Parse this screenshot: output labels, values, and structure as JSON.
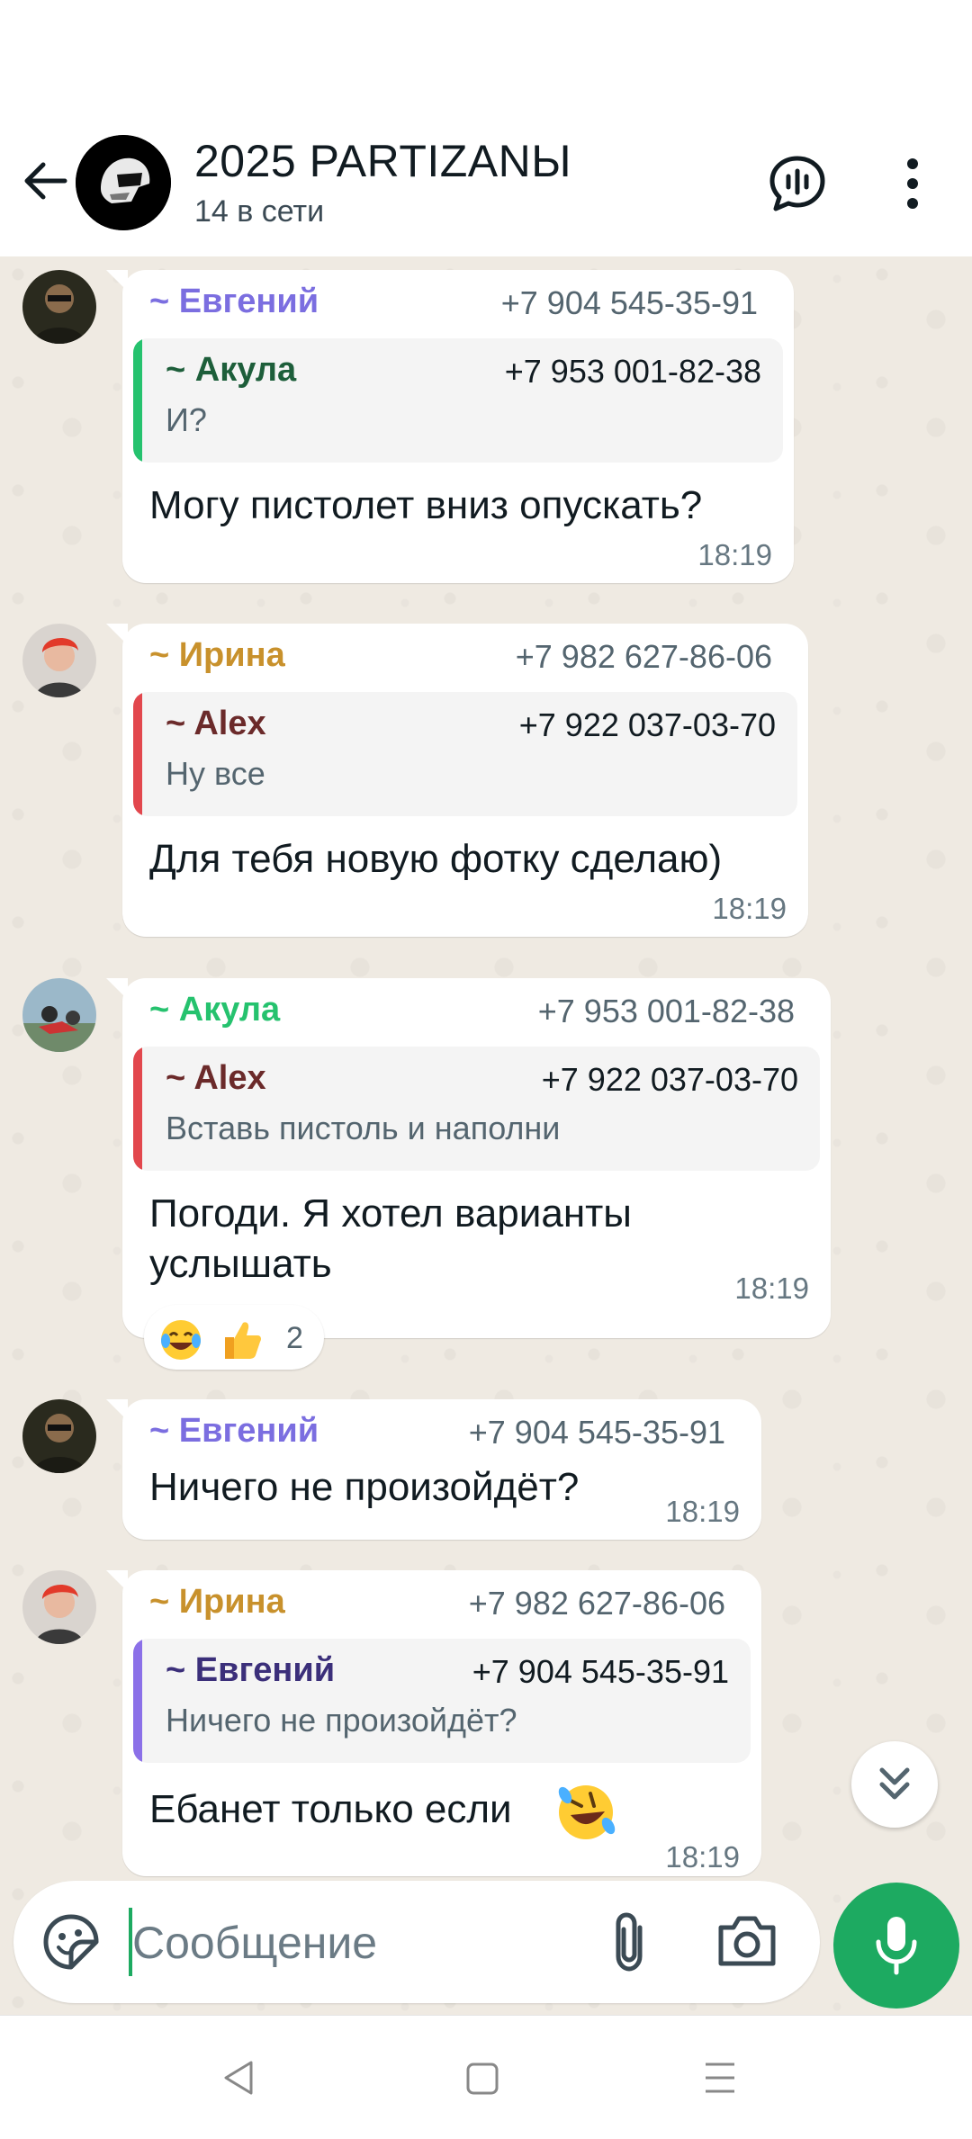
{
  "header": {
    "title": "2025 PARTIZANЫ",
    "subtitle": "14 в сети"
  },
  "colors": {
    "accent": "#1daa61",
    "chat_background": "#efeae2",
    "sender_evgeny": "#7b6ee0",
    "sender_irina": "#c8912c",
    "sender_akula": "#25c26e",
    "reply_akula": "#1d5e3a",
    "reply_alex": "#6b2a2a",
    "reply_evgeny": "#3b2f7a"
  },
  "messages": [
    {
      "sender": "~ Евгений",
      "phone": "+7 904 545-35-91",
      "reply": {
        "name": "~ Акула",
        "phone": "+7 953 001-82-38",
        "text": "И?"
      },
      "text": "Могу пистолет вниз опускать?",
      "time": "18:19"
    },
    {
      "sender": "~ Ирина",
      "phone": "+7 982 627-86-06",
      "reply": {
        "name": "~ Alex",
        "phone": "+7 922 037-03-70",
        "text": "Ну все"
      },
      "text": "Для тебя новую фотку сделаю)",
      "time": "18:19"
    },
    {
      "sender": "~ Акула",
      "phone": "+7 953 001-82-38",
      "reply": {
        "name": "~ Alex",
        "phone": "+7 922 037-03-70",
        "text": "Вставь пистоль и наполни"
      },
      "text_line1": "Погоди. Я хотел варианты",
      "text_line2": "услышать",
      "time": "18:19",
      "reactions": {
        "emojis": [
          "face-with-tears-of-joy",
          "thumbs-up"
        ],
        "count": "2"
      }
    },
    {
      "sender": "~ Евгений",
      "phone": "+7 904 545-35-91",
      "text": "Ничего не произойдёт?",
      "time": "18:19"
    },
    {
      "sender": "~ Ирина",
      "phone": "+7 982 627-86-06",
      "reply": {
        "name": "~ Евгений",
        "phone": "+7 904 545-35-91",
        "text": "Ничего не произойдёт?"
      },
      "text": "Ебанет только если",
      "text_emoji": "rolling-on-the-floor-laughing",
      "time": "18:19"
    }
  ],
  "composer": {
    "placeholder": "Сообщение"
  }
}
